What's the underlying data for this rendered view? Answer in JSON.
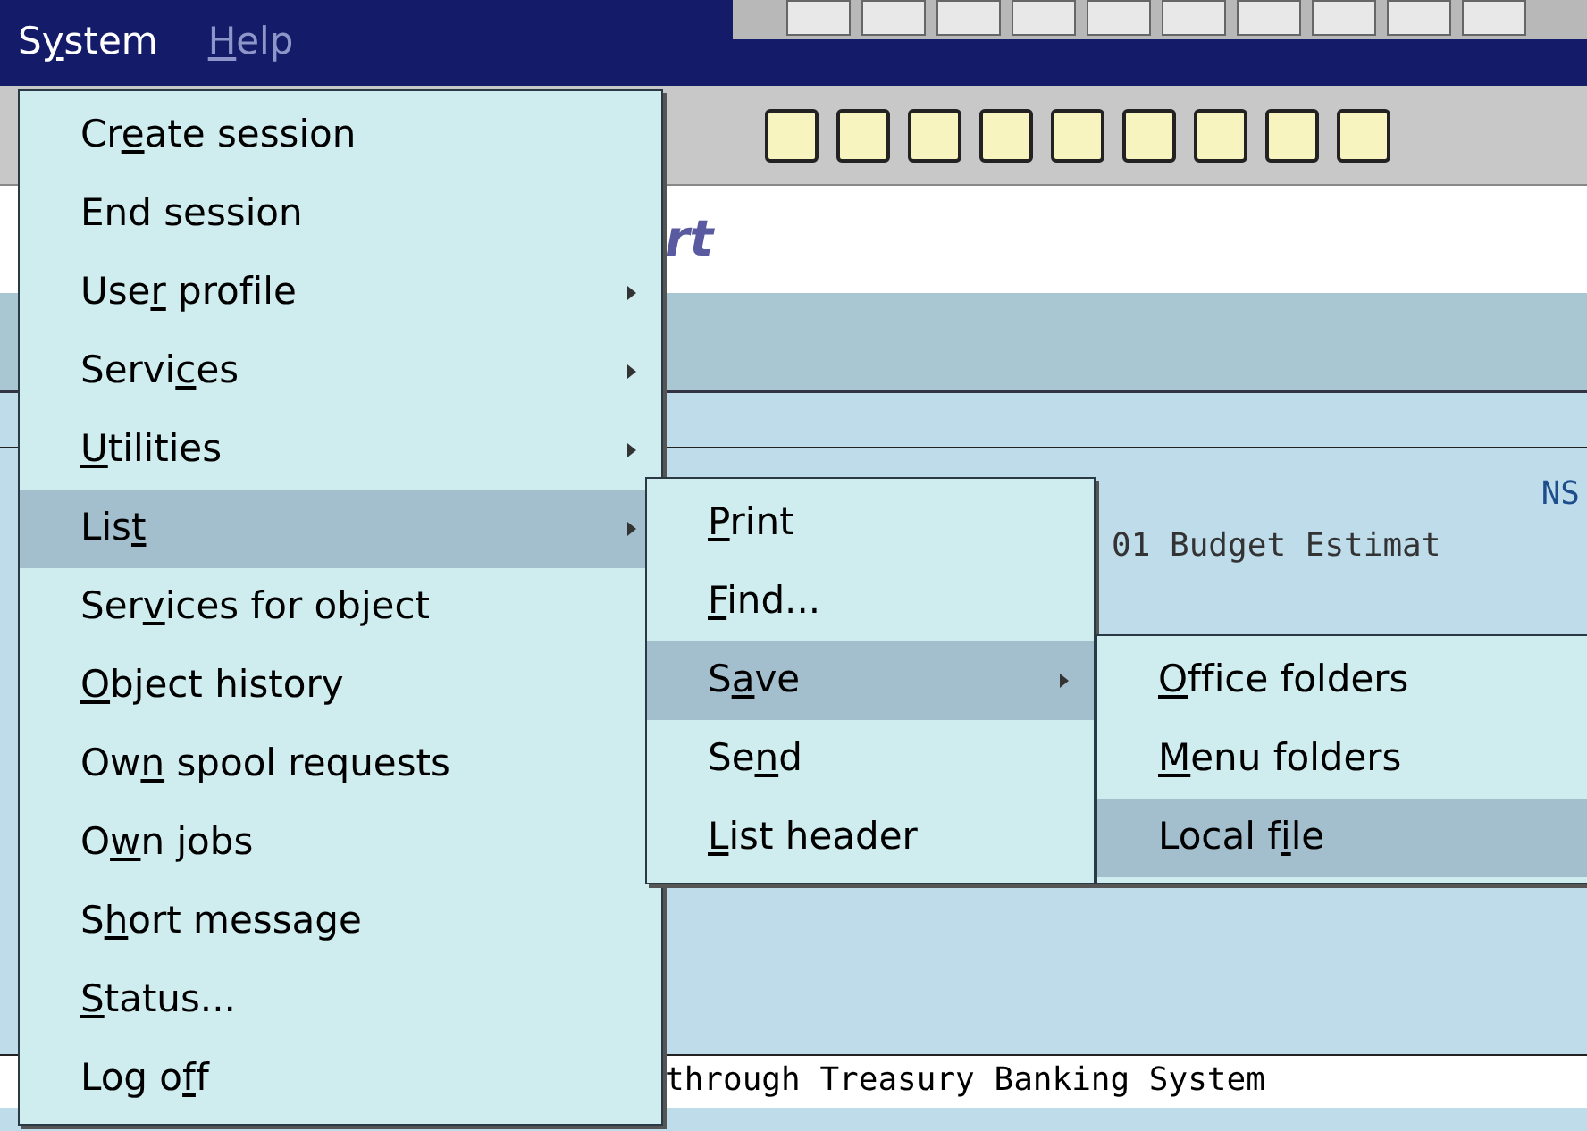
{
  "menu_bar": [
    {
      "label": {
        "before": "S",
        "key": "y",
        "after": "stem"
      },
      "selected": true
    },
    {
      "label": {
        "key": "H",
        "after": "elp"
      },
      "selected": false
    }
  ],
  "screen": {
    "title_fragment": "rt",
    "column_header_fragment": "NS",
    "row_fragment": "01 Budget Estimat",
    "footer_fragment": "through Treasury Banking System"
  },
  "system_menu": [
    {
      "label": {
        "before": "Cr",
        "key": "e",
        "after": "ate session"
      },
      "submenu": false,
      "selected": false
    },
    {
      "label": {
        "before": "End session"
      },
      "submenu": false,
      "selected": false
    },
    {
      "label": {
        "before": "Use",
        "key": "r",
        "after": " profile"
      },
      "submenu": true,
      "selected": false
    },
    {
      "label": {
        "before": "Servi",
        "key": "c",
        "after": "es"
      },
      "submenu": true,
      "selected": false
    },
    {
      "label": {
        "key": "U",
        "after": "tilities"
      },
      "submenu": true,
      "selected": false
    },
    {
      "label": {
        "before": "Lis",
        "key": "t"
      },
      "submenu": true,
      "selected": true
    },
    {
      "label": {
        "before": "Ser",
        "key": "v",
        "after": "ices for object"
      },
      "submenu": false,
      "selected": false
    },
    {
      "label": {
        "key": "O",
        "after": "bject history"
      },
      "submenu": false,
      "selected": false
    },
    {
      "label": {
        "before": "Ow",
        "key": "n",
        "after": " spool requests"
      },
      "submenu": false,
      "selected": false
    },
    {
      "label": {
        "before": "O",
        "key": "w",
        "after": "n jobs"
      },
      "submenu": false,
      "selected": false
    },
    {
      "label": {
        "before": "S",
        "key": "h",
        "after": "ort message"
      },
      "submenu": false,
      "selected": false
    },
    {
      "label": {
        "key": "S",
        "after": "tatus..."
      },
      "submenu": false,
      "selected": false
    },
    {
      "label": {
        "before": "Log o",
        "key": "f",
        "after": "f"
      },
      "submenu": false,
      "selected": false
    }
  ],
  "list_menu": [
    {
      "label": {
        "key": "P",
        "after": "rint"
      },
      "submenu": false,
      "selected": false
    },
    {
      "label": {
        "key": "F",
        "after": "ind..."
      },
      "submenu": false,
      "selected": false
    },
    {
      "label": {
        "before": "S",
        "key": "a",
        "after": "ve"
      },
      "submenu": true,
      "selected": true
    },
    {
      "label": {
        "before": "Se",
        "key": "n",
        "after": "d"
      },
      "submenu": false,
      "selected": false
    },
    {
      "label": {
        "key": "L",
        "after": "ist header"
      },
      "submenu": false,
      "selected": false
    }
  ],
  "save_menu": [
    {
      "label": {
        "key": "O",
        "after": "ffice folders"
      },
      "submenu": false,
      "selected": false
    },
    {
      "label": {
        "key": "M",
        "after": "enu folders"
      },
      "submenu": false,
      "selected": false
    },
    {
      "label": {
        "before": "Local f",
        "key": "i",
        "after": "le"
      },
      "submenu": false,
      "selected": true
    }
  ]
}
